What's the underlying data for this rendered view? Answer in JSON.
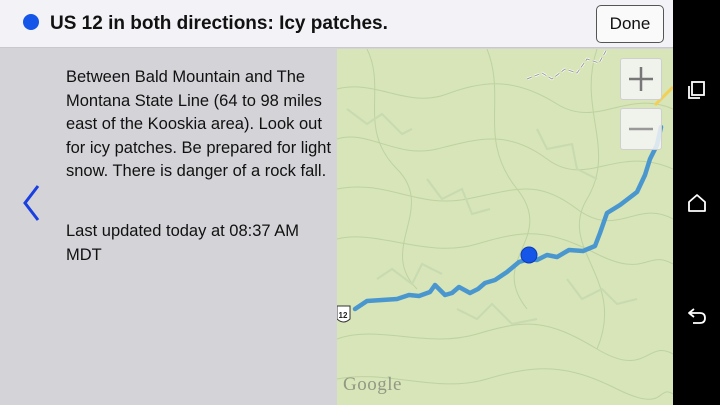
{
  "header": {
    "title": "US 12 in both directions: Icy patches.",
    "done_label": "Done",
    "status_color": "#1556e8"
  },
  "detail": {
    "description": "Between Bald Mountain and The Montana State Line (64 to 98 miles east of the Kooskia area). Look out for icy patches. Be prepared for light snow. There is danger of a rock fall.",
    "last_updated": "Last updated today at 08:37 AM MDT"
  },
  "map": {
    "route_shield": "12",
    "attribution": "Google",
    "route_color": "#4a97cf",
    "marker_color": "#1556e8",
    "zoom_in_icon": "plus-icon",
    "zoom_out_icon": "minus-icon"
  },
  "navigation": {
    "back_icon": "chevron-left-icon",
    "system_icons": [
      "recents-icon",
      "home-icon",
      "back-icon"
    ]
  }
}
